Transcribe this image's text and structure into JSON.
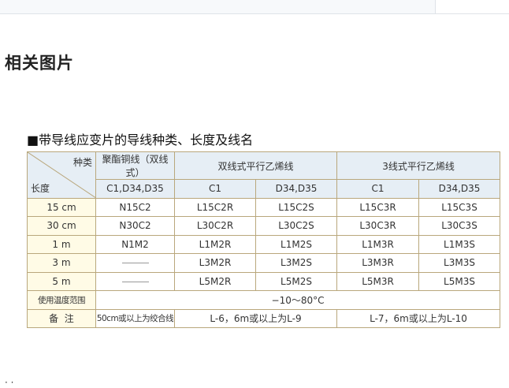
{
  "section_title": "相关图片",
  "table": {
    "caption": "■带导线应变片的导线种类、长度及线名",
    "corner": {
      "top_right": "种类",
      "bottom_left": "长度"
    },
    "groups": [
      "聚酯铜线（双线式）",
      "双线式平行乙烯线",
      "3线式平行乙烯线"
    ],
    "subheaders": [
      "C1,D34,D35",
      "C1",
      "D34,D35",
      "C1",
      "D34,D35"
    ],
    "rows": [
      {
        "length": "15 cm",
        "cells": [
          "N15C2",
          "L15C2R",
          "L15C2S",
          "L15C3R",
          "L15C3S"
        ]
      },
      {
        "length": "30 cm",
        "cells": [
          "N30C2",
          "L30C2R",
          "L30C2S",
          "L30C3R",
          "L30C3S"
        ]
      },
      {
        "length": "1 m",
        "cells": [
          "N1M2",
          "L1M2R",
          "L1M2S",
          "L1M3R",
          "L1M3S"
        ]
      },
      {
        "length": "3 m",
        "cells": [
          "",
          "L3M2R",
          "L3M2S",
          "L3M3R",
          "L3M3S"
        ]
      },
      {
        "length": "5 m",
        "cells": [
          "",
          "L5M2R",
          "L5M2S",
          "L5M3R",
          "L5M3S"
        ]
      }
    ],
    "temp": {
      "label": "使用温度范围",
      "value": "−10～80°C"
    },
    "notes": {
      "label": "备  注",
      "values": [
        "50cm或以上为绞合线",
        "L-6，6m或以上为L-9",
        "L-7，6m或以上为L-10"
      ]
    }
  }
}
